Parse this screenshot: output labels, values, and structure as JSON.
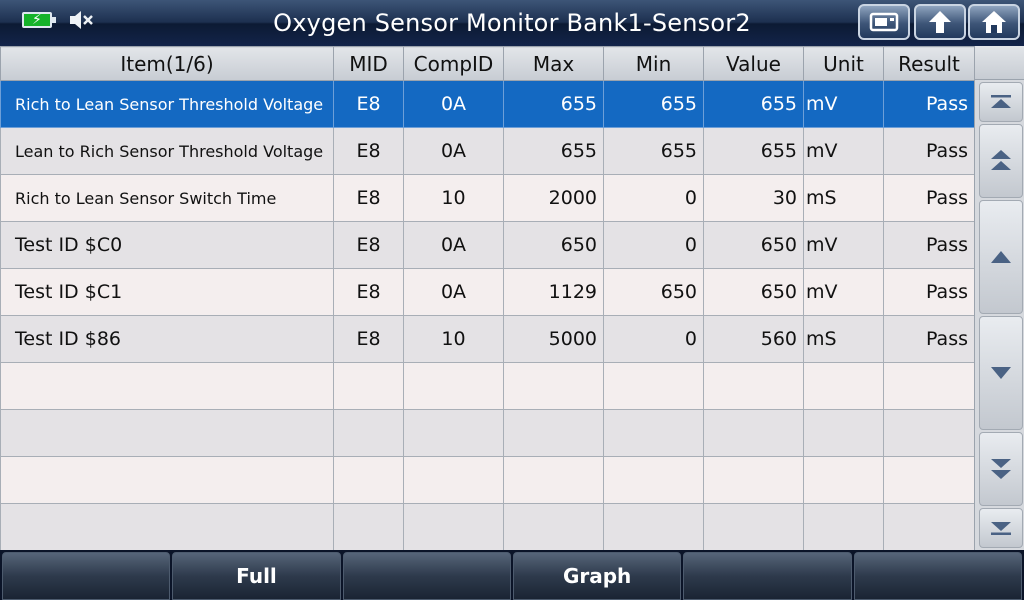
{
  "header": {
    "title": "Oxygen Sensor Monitor Bank1-Sensor2",
    "icons": [
      "battery-charging-icon",
      "speaker-muted-icon",
      "screenshot-icon",
      "back-up-icon",
      "home-icon"
    ]
  },
  "table": {
    "columns": [
      "Item(1/6)",
      "MID",
      "CompID",
      "Max",
      "Min",
      "Value",
      "Unit",
      "Result"
    ],
    "rows": [
      {
        "item": "Rich to Lean Sensor Threshold Voltage",
        "mid": "E8",
        "compid": "0A",
        "max": "655",
        "min": "655",
        "value": "655",
        "unit": "mV",
        "result": "Pass"
      },
      {
        "item": "Lean to Rich Sensor Threshold Voltage",
        "mid": "E8",
        "compid": "0A",
        "max": "655",
        "min": "655",
        "value": "655",
        "unit": "mV",
        "result": "Pass"
      },
      {
        "item": "Rich to Lean Sensor Switch Time",
        "mid": "E8",
        "compid": "10",
        "max": "2000",
        "min": "0",
        "value": "30",
        "unit": "mS",
        "result": "Pass"
      },
      {
        "item": "Test ID $C0",
        "mid": "E8",
        "compid": "0A",
        "max": "650",
        "min": "0",
        "value": "650",
        "unit": "mV",
        "result": "Pass"
      },
      {
        "item": "Test ID $C1",
        "mid": "E8",
        "compid": "0A",
        "max": "1129",
        "min": "650",
        "value": "650",
        "unit": "mV",
        "result": "Pass"
      },
      {
        "item": "Test ID $86",
        "mid": "E8",
        "compid": "10",
        "max": "5000",
        "min": "0",
        "value": "560",
        "unit": "mS",
        "result": "Pass"
      }
    ],
    "selected_row": 1
  },
  "scroll_buttons": [
    "scroll-top-icon",
    "page-up-icon",
    "line-up-icon",
    "line-down-icon",
    "page-down-icon",
    "scroll-bottom-icon"
  ],
  "footer": {
    "buttons": [
      "",
      "Full",
      "",
      "Graph",
      "",
      ""
    ]
  },
  "colors": {
    "selected_row": "#1469c2",
    "title_bar": "#13244a",
    "battery": "#16b32a"
  }
}
